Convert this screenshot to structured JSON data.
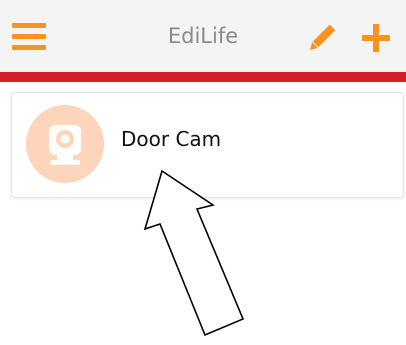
{
  "colors": {
    "accent": "#f7931e",
    "header_bg": "#f4f4f4",
    "red_bar": "#d71f26",
    "avatar_bg": "#fcd5bb"
  },
  "header": {
    "title": "EdiLife",
    "menu_icon": "hamburger-menu-icon",
    "edit_icon": "pencil-icon",
    "add_icon": "plus-icon"
  },
  "devices": [
    {
      "name": "Door Cam",
      "icon": "camera-icon"
    }
  ]
}
